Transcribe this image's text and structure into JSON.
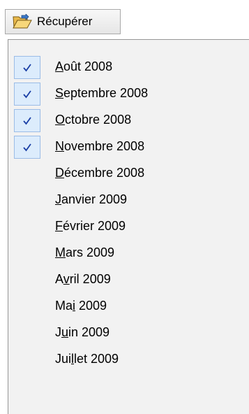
{
  "toolbar": {
    "recuperer_label": "Récupérer",
    "icon": "open-folder-icon"
  },
  "menu": {
    "items": [
      {
        "pre": "",
        "key": "A",
        "post": "oût 2008",
        "checked": true
      },
      {
        "pre": "",
        "key": "S",
        "post": "eptembre 2008",
        "checked": true
      },
      {
        "pre": "",
        "key": "O",
        "post": "ctobre 2008",
        "checked": true
      },
      {
        "pre": "",
        "key": "N",
        "post": "ovembre 2008",
        "checked": true
      },
      {
        "pre": "",
        "key": "D",
        "post": "écembre 2008",
        "checked": false
      },
      {
        "pre": "",
        "key": "J",
        "post": "anvier 2009",
        "checked": false
      },
      {
        "pre": "",
        "key": "F",
        "post": "évrier 2009",
        "checked": false
      },
      {
        "pre": "",
        "key": "M",
        "post": "ars 2009",
        "checked": false
      },
      {
        "pre": "A",
        "key": "v",
        "post": "ril 2009",
        "checked": false
      },
      {
        "pre": "Ma",
        "key": "i",
        "post": " 2009",
        "checked": false
      },
      {
        "pre": "J",
        "key": "u",
        "post": "in 2009",
        "checked": false
      },
      {
        "pre": "Jui",
        "key": "l",
        "post": "let 2009",
        "checked": false
      }
    ]
  },
  "colors": {
    "check_mark": "#1a3fa6",
    "check_bg": "#dcecfc",
    "check_border": "#9bbce6"
  }
}
